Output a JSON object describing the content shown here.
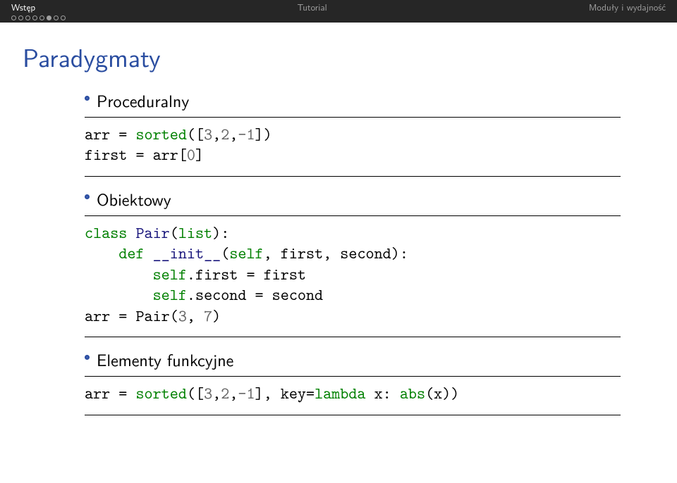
{
  "nav": {
    "left": "Wstęp",
    "center": "Tutorial",
    "right": "Moduły i wydajność"
  },
  "progress": {
    "total": 8,
    "current": 5
  },
  "title": "Paradygmaty",
  "bullets": {
    "b1": "Proceduralny",
    "b2": "Obiektowy",
    "b3": "Elementy funkcyjne"
  },
  "code": {
    "c1": {
      "l1a": "arr = ",
      "l1b": "sorted",
      "l1c": "([",
      "l1d": "3",
      "l1e": ",",
      "l1f": "2",
      "l1g": ",",
      "l1h": "-",
      "l1i": "1",
      "l1j": "])",
      "l2a": "first = arr[",
      "l2b": "0",
      "l2c": "]"
    },
    "c2": {
      "l1a": "class",
      "l1b": " Pair",
      "l1c": "(",
      "l1d": "list",
      "l1e": "):",
      "l2a": "    ",
      "l2b": "def",
      "l2c": " ",
      "l2d": "__init__",
      "l2e": "(",
      "l2f": "self",
      "l2g": ", first, second):",
      "l3a": "        ",
      "l3b": "self",
      "l3c": ".first = first",
      "l4a": "        ",
      "l4b": "self",
      "l4c": ".second = second",
      "l5a": "arr = Pair(",
      "l5b": "3",
      "l5c": ", ",
      "l5d": "7",
      "l5e": ")"
    },
    "c3": {
      "l1a": "arr = ",
      "l1b": "sorted",
      "l1c": "([",
      "l1d": "3",
      "l1e": ",",
      "l1f": "2",
      "l1g": ",",
      "l1h": "-",
      "l1i": "1",
      "l1j": "], key=",
      "l1k": "lambda",
      "l1l": " x: ",
      "l1m": "abs",
      "l1n": "(x))"
    }
  }
}
